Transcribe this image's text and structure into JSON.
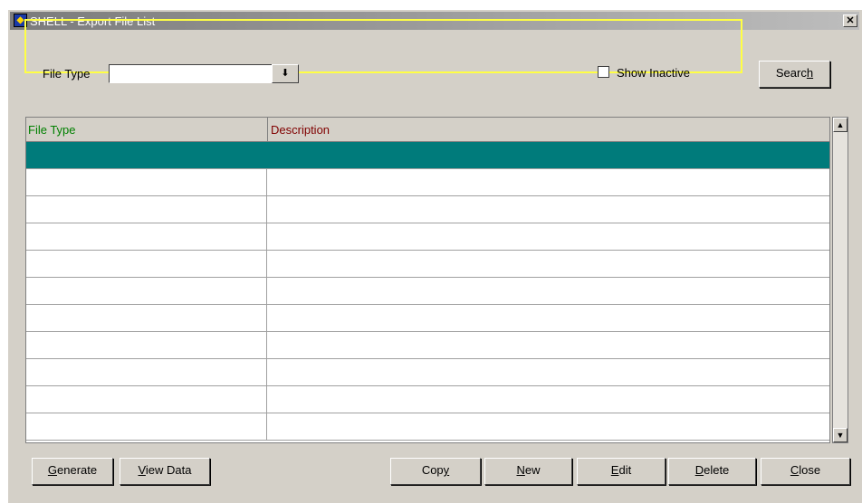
{
  "window": {
    "title": "SHELL - Export File List",
    "close_label": "✕"
  },
  "filter": {
    "file_type_label": "File Type",
    "file_type_value": "",
    "dropdown_arrow": "⬇",
    "show_inactive_label": "Show Inactive",
    "show_inactive_checked": false
  },
  "buttons": {
    "search": {
      "pre": "Searc",
      "u": "h",
      "post": ""
    },
    "generate": {
      "pre": "",
      "u": "G",
      "post": "enerate"
    },
    "view_data": {
      "pre": "",
      "u": "V",
      "post": "iew Data"
    },
    "copy": {
      "pre": "Cop",
      "u": "y",
      "post": ""
    },
    "new": {
      "pre": "",
      "u": "N",
      "post": "ew"
    },
    "edit": {
      "pre": "",
      "u": "E",
      "post": "dit"
    },
    "delete": {
      "pre": "",
      "u": "D",
      "post": "elete"
    },
    "close": {
      "pre": "",
      "u": "C",
      "post": "lose"
    }
  },
  "grid": {
    "columns": [
      {
        "label": "File Type",
        "color": "#008000"
      },
      {
        "label": "Description",
        "color": "#800000"
      }
    ],
    "rows": [
      [
        "",
        ""
      ],
      [
        "",
        ""
      ],
      [
        "",
        ""
      ],
      [
        "",
        ""
      ],
      [
        "",
        ""
      ],
      [
        "",
        ""
      ],
      [
        "",
        ""
      ],
      [
        "",
        ""
      ],
      [
        "",
        ""
      ],
      [
        "",
        ""
      ],
      [
        "",
        ""
      ]
    ],
    "selected_row": 0,
    "selection_color": "#007b7b"
  },
  "scrollbar": {
    "up_icon": "▲",
    "down_icon": "▼"
  }
}
